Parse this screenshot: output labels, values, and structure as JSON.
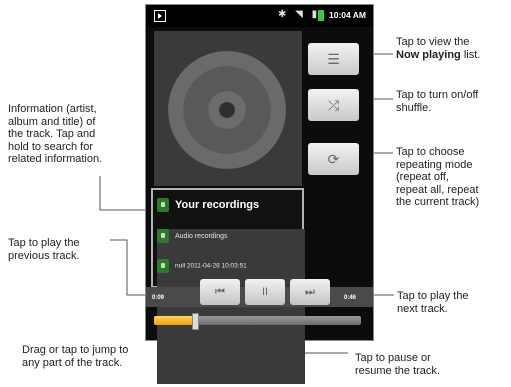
{
  "status_bar": {
    "time": "10:04 AM",
    "icons": [
      "app-notification-icon",
      "bluetooth-icon",
      "wifi-icon",
      "signal-icon",
      "battery-icon"
    ]
  },
  "player": {
    "track_title": "Your recordings",
    "album": "Audio recordings",
    "artist": "null 2011-04-28 10:03:51",
    "elapsed": "0:09",
    "duration": "0:46",
    "progress": 0.2,
    "side_buttons": [
      {
        "name": "now-playing-list-button",
        "icon": "list-icon",
        "glyph": "☰"
      },
      {
        "name": "shuffle-button",
        "icon": "shuffle-icon",
        "glyph": "⤮"
      },
      {
        "name": "repeat-button",
        "icon": "repeat-icon",
        "glyph": "⟳"
      }
    ],
    "controls": [
      {
        "name": "previous-track-button",
        "icon": "previous-track-icon",
        "glyph": "⏮"
      },
      {
        "name": "pause-button",
        "icon": "pause-icon",
        "glyph": "II"
      },
      {
        "name": "next-track-button",
        "icon": "next-track-icon",
        "glyph": "⏭"
      }
    ]
  },
  "callouts": {
    "now_playing_pre": "Tap to view the",
    "now_playing_bold": "Now playing",
    "now_playing_post": "list.",
    "shuffle_1": "Tap to turn on/off",
    "shuffle_2": "shuffle.",
    "repeat_1": "Tap to choose",
    "repeat_2": "repeating mode",
    "repeat_3": "(repeat off,",
    "repeat_4": "repeat all, repeat",
    "repeat_5": "the current track)",
    "info_1": "Information (artist,",
    "info_2": "album and title) of",
    "info_3": "the track. Tap and",
    "info_4": "hold to search for",
    "info_5": "related information.",
    "prev_1": "Tap to play the",
    "prev_2": "previous track.",
    "next_1": "Tap to play the",
    "next_2": "next track.",
    "drag_1": "Drag or tap to jump to",
    "drag_2": "any part of the track.",
    "pause_1": "Tap to pause or",
    "pause_2": "resume the track."
  },
  "colors": {
    "progress_fill": "#f2a100",
    "screen_bg": "#0c0c0c",
    "icon_green": "#2d7a2d"
  }
}
